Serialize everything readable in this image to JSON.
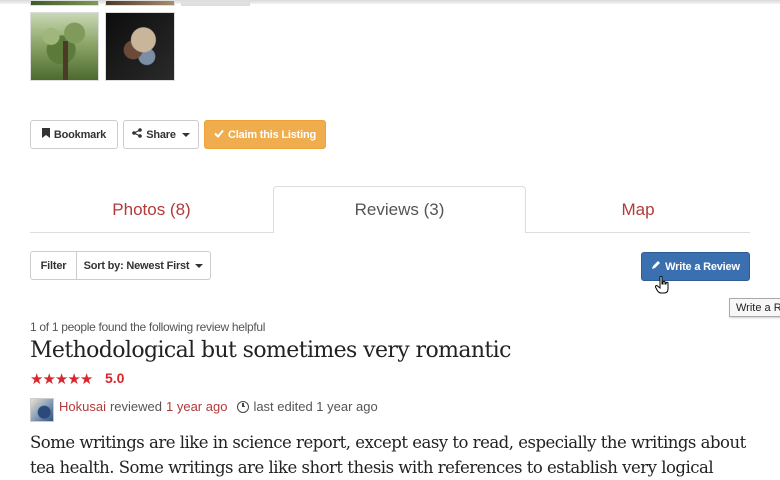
{
  "actions": {
    "bookmark_label": "Bookmark",
    "share_label": "Share",
    "claim_label": "Claim this Listing"
  },
  "tabs": [
    {
      "label": "Photos (8)"
    },
    {
      "label": "Reviews (3)"
    },
    {
      "label": "Map"
    }
  ],
  "toolbar": {
    "filter_label": "Filter",
    "sort_label": "Sort by: Newest First",
    "write_review_label": "Write a Review",
    "tooltip_text": "Write a Review"
  },
  "review": {
    "helpful_text": "1 of 1 people found the following review helpful",
    "title": "Methodological but sometimes very romantic",
    "rating": "5.0",
    "stars": 5,
    "author": "Hokusai",
    "reviewed_word": "reviewed",
    "reviewed_when": "1 year ago",
    "edited_text": "last edited 1 year ago",
    "body": "Some writings are like in science report, except easy to read, especially the writings about tea health. Some writings are like short thesis with references to establish very logical"
  },
  "colors": {
    "accent_red": "#b23a3a",
    "star_red": "#d9262c",
    "claim_orange": "#f0ad4e",
    "write_blue": "#3a6fb0"
  },
  "icons": {
    "bookmark": "bookmark-icon",
    "share": "share-icon",
    "claim": "check-icon",
    "write": "pencil-icon",
    "clock": "clock-icon"
  }
}
